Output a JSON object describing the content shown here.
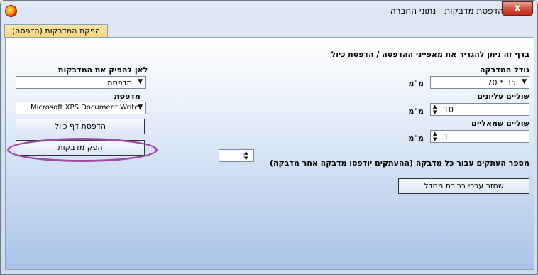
{
  "window": {
    "title": "הדפסת מדבקות - נתוני החברה",
    "close_label": "x",
    "tab_label": "הפקת המדבקות (הדפסה)"
  },
  "form": {
    "intro": "בדף זה ניתן להגדיר את מאפייני ההדפסה / הדפסת כיול",
    "label_size_label": "גודל המדבקה",
    "label_size_value": "35 * 70",
    "unit_mm": "מ\"מ",
    "top_margin_label": "שוליים עליונים",
    "top_margin_value": "10",
    "left_margin_label": "שוליים שמאליים",
    "left_margin_value": "1",
    "copies_label": "מספר העתקים עבור כל מדבקה (ההעתקים יודפסו מדבקה אחר מדבקה)",
    "copies_value": "1",
    "reset_button": "שחזר ערכי ברירת מחדל",
    "destination_label": "לאן להפיק את המדבקות",
    "destination_value": "מדפסת",
    "printer_label": "מדפסת",
    "printer_value": "Microsoft XPS Document Writer",
    "calibration_button": "הדפסת דף כיול",
    "print_button": "הפק מדבקות"
  }
}
